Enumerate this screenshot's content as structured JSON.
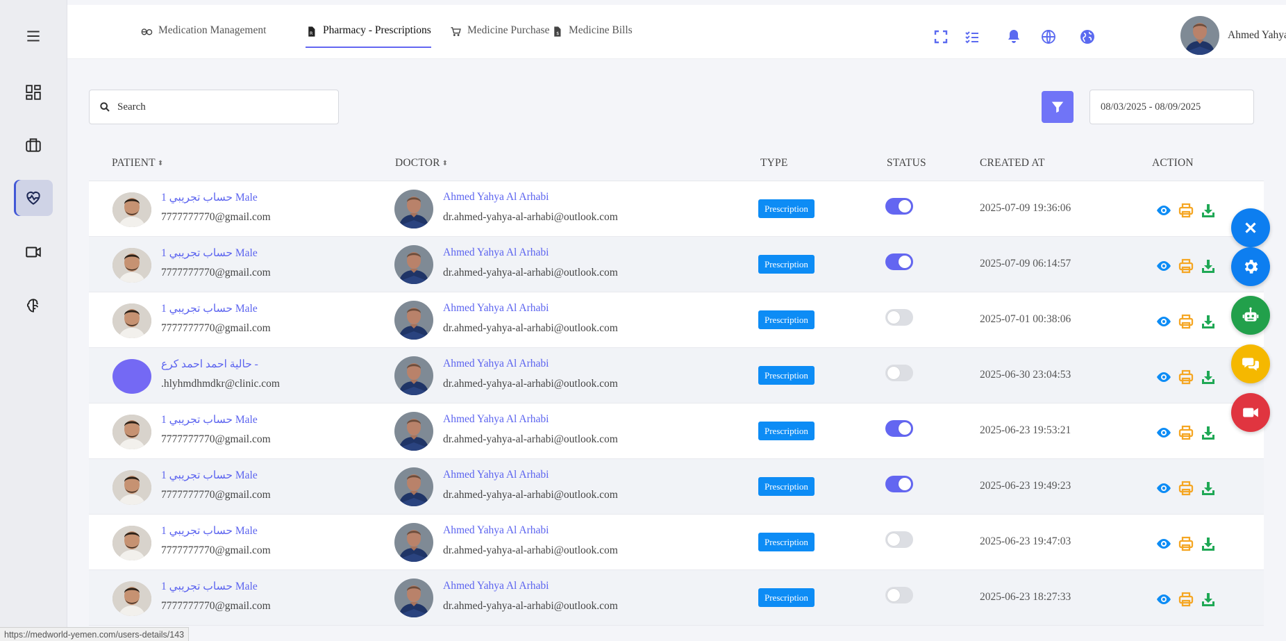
{
  "sidebar": {
    "items": [
      {
        "icon": "hamburger-menu-icon"
      },
      {
        "icon": "dashboard-grid-icon"
      },
      {
        "icon": "briefcase-icon"
      },
      {
        "icon": "heart-pulse-icon",
        "active": true
      },
      {
        "icon": "video-camera-icon"
      },
      {
        "icon": "brain-icon"
      }
    ]
  },
  "topnav": {
    "tabs": [
      {
        "label": "Medication Management",
        "icon": "pills-icon"
      },
      {
        "label": "Pharmacy - Prescriptions",
        "icon": "prescription-file-icon",
        "active": true
      },
      {
        "label": "Medicine Purchase",
        "icon": "cart-icon"
      },
      {
        "label": "Medicine Bills",
        "icon": "bill-file-icon"
      }
    ],
    "icons": [
      "fullscreen-icon",
      "checklist-icon",
      "bell-icon",
      "globe-icon",
      "earth-icon"
    ],
    "user_name": "Ahmed Yahya Al Arhabi"
  },
  "toolbar": {
    "search_placeholder": "Search",
    "date_range": "08/03/2025 - 08/09/2025"
  },
  "table": {
    "columns": [
      "PATIENT",
      "DOCTOR",
      "TYPE",
      "STATUS",
      "CREATED AT",
      "ACTION"
    ],
    "rows": [
      {
        "patient_name": "حساب تجريبي 1 Male",
        "patient_email": "7777777770@gmail.com",
        "doctor_name": "Ahmed Yahya Al Arhabi",
        "doctor_email": "dr.ahmed-yahya-al-arhabi@outlook.com",
        "type": "Prescription",
        "status_on": true,
        "created": "2025-07-09 19:36:06",
        "avatar": "photo"
      },
      {
        "patient_name": "حساب تجريبي 1 Male",
        "patient_email": "7777777770@gmail.com",
        "doctor_name": "Ahmed Yahya Al Arhabi",
        "doctor_email": "dr.ahmed-yahya-al-arhabi@outlook.com",
        "type": "Prescription",
        "status_on": true,
        "created": "2025-07-09 06:14:57",
        "avatar": "photo"
      },
      {
        "patient_name": "حساب تجريبي 1 Male",
        "patient_email": "7777777770@gmail.com",
        "doctor_name": "Ahmed Yahya Al Arhabi",
        "doctor_email": "dr.ahmed-yahya-al-arhabi@outlook.com",
        "type": "Prescription",
        "status_on": false,
        "created": "2025-07-01 00:38:06",
        "avatar": "photo"
      },
      {
        "patient_name": "حالية احمد احمد كرع -",
        "patient_email": ".hlyhmdhmdkr@clinic.com",
        "doctor_name": "Ahmed Yahya Al Arhabi",
        "doctor_email": "dr.ahmed-yahya-al-arhabi@outlook.com",
        "type": "Prescription",
        "status_on": false,
        "created": "2025-06-30 23:04:53",
        "avatar": "placeholder"
      },
      {
        "patient_name": "حساب تجريبي 1 Male",
        "patient_email": "7777777770@gmail.com",
        "doctor_name": "Ahmed Yahya Al Arhabi",
        "doctor_email": "dr.ahmed-yahya-al-arhabi@outlook.com",
        "type": "Prescription",
        "status_on": true,
        "created": "2025-06-23 19:53:21",
        "avatar": "photo"
      },
      {
        "patient_name": "حساب تجريبي 1 Male",
        "patient_email": "7777777770@gmail.com",
        "doctor_name": "Ahmed Yahya Al Arhabi",
        "doctor_email": "dr.ahmed-yahya-al-arhabi@outlook.com",
        "type": "Prescription",
        "status_on": true,
        "created": "2025-06-23 19:49:23",
        "avatar": "photo"
      },
      {
        "patient_name": "حساب تجريبي 1 Male",
        "patient_email": "7777777770@gmail.com",
        "doctor_name": "Ahmed Yahya Al Arhabi",
        "doctor_email": "dr.ahmed-yahya-al-arhabi@outlook.com",
        "type": "Prescription",
        "status_on": false,
        "created": "2025-06-23 19:47:03",
        "avatar": "photo"
      },
      {
        "patient_name": "حساب تجريبي 1 Male",
        "patient_email": "7777777770@gmail.com",
        "doctor_name": "Ahmed Yahya Al Arhabi",
        "doctor_email": "dr.ahmed-yahya-al-arhabi@outlook.com",
        "type": "Prescription",
        "status_on": false,
        "created": "2025-06-23 18:27:33",
        "avatar": "photo"
      }
    ]
  },
  "fabs": [
    {
      "icon": "close-icon",
      "color": "#0d7ef0"
    },
    {
      "icon": "gear-icon",
      "color": "#0d7ef0"
    },
    {
      "icon": "robot-icon",
      "color": "#22a04b"
    },
    {
      "icon": "chat-bubbles-icon",
      "color": "#f5b800"
    },
    {
      "icon": "video-call-icon",
      "color": "#e03540"
    }
  ],
  "status_bar_url": "https://medworld-yemen.com/users-details/143",
  "colors": {
    "accent": "#6366f1",
    "badge": "#0d8cf5",
    "view": "#0d8cf5",
    "print": "#f5a623",
    "download": "#1fa855"
  }
}
